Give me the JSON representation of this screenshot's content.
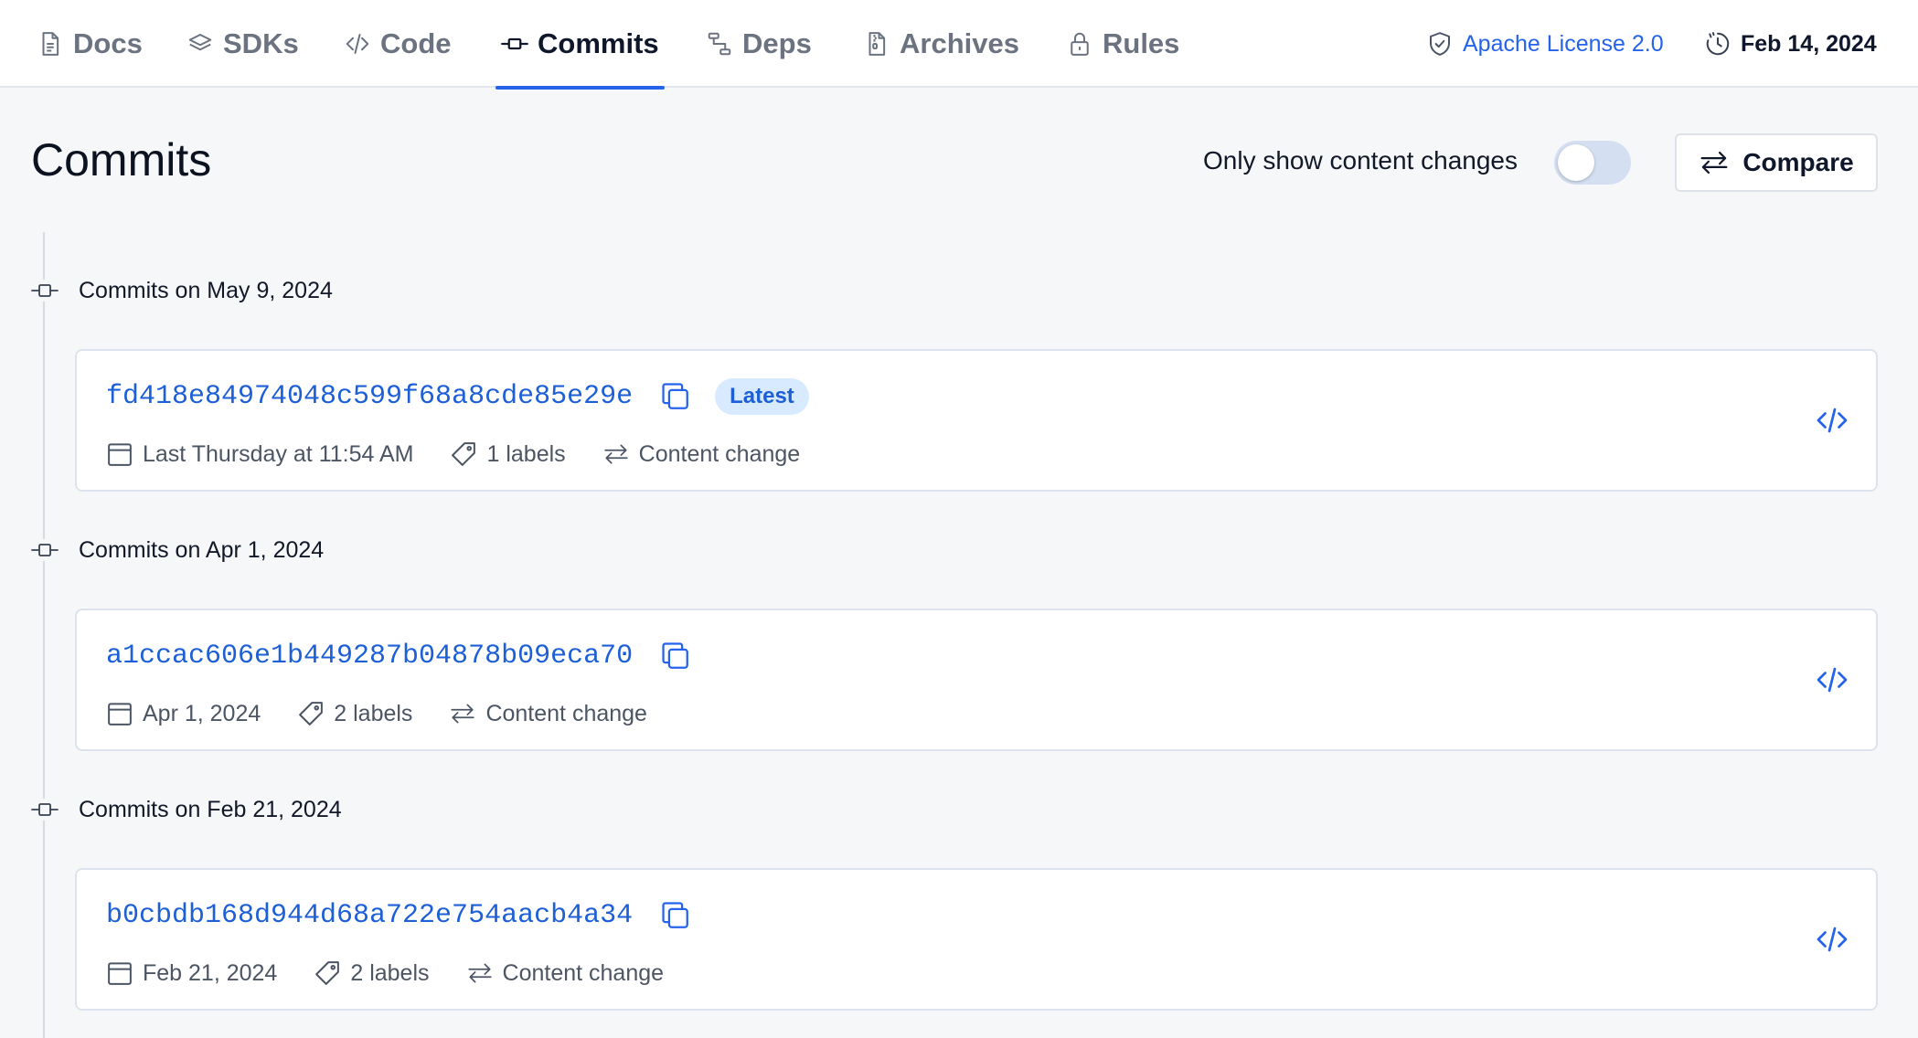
{
  "nav": {
    "tabs": [
      {
        "label": "Docs",
        "icon": "document-icon"
      },
      {
        "label": "SDKs",
        "icon": "layers-icon"
      },
      {
        "label": "Code",
        "icon": "code-icon"
      },
      {
        "label": "Commits",
        "icon": "commit-icon",
        "active": true
      },
      {
        "label": "Deps",
        "icon": "dependency-icon"
      },
      {
        "label": "Archives",
        "icon": "archive-file-icon"
      },
      {
        "label": "Rules",
        "icon": "lock-icon"
      }
    ],
    "license": "Apache License 2.0",
    "date": "Feb 14, 2024"
  },
  "header": {
    "title": "Commits",
    "toggle_label": "Only show content changes",
    "toggle_on": false,
    "compare_label": "Compare"
  },
  "groups": [
    {
      "heading": "Commits on May 9, 2024",
      "commit": {
        "hash": "fd418e84974048c599f68a8cde85e29e",
        "badge": "Latest",
        "date": "Last Thursday at 11:54 AM",
        "labels": "1 labels",
        "change": "Content change"
      }
    },
    {
      "heading": "Commits on Apr 1, 2024",
      "commit": {
        "hash": "a1ccac606e1b449287b04878b09eca70",
        "date": "Apr 1, 2024",
        "labels": "2 labels",
        "change": "Content change"
      }
    },
    {
      "heading": "Commits on Feb 21, 2024",
      "commit": {
        "hash": "b0cbdb168d944d68a722e754aacb4a34",
        "date": "Feb 21, 2024",
        "labels": "2 labels",
        "change": "Content change"
      }
    }
  ],
  "colors": {
    "accent": "#2563eb",
    "hash": "#1d5fd6",
    "badge_bg": "#d7eaff",
    "toggle_off": "#d4e0f2"
  }
}
